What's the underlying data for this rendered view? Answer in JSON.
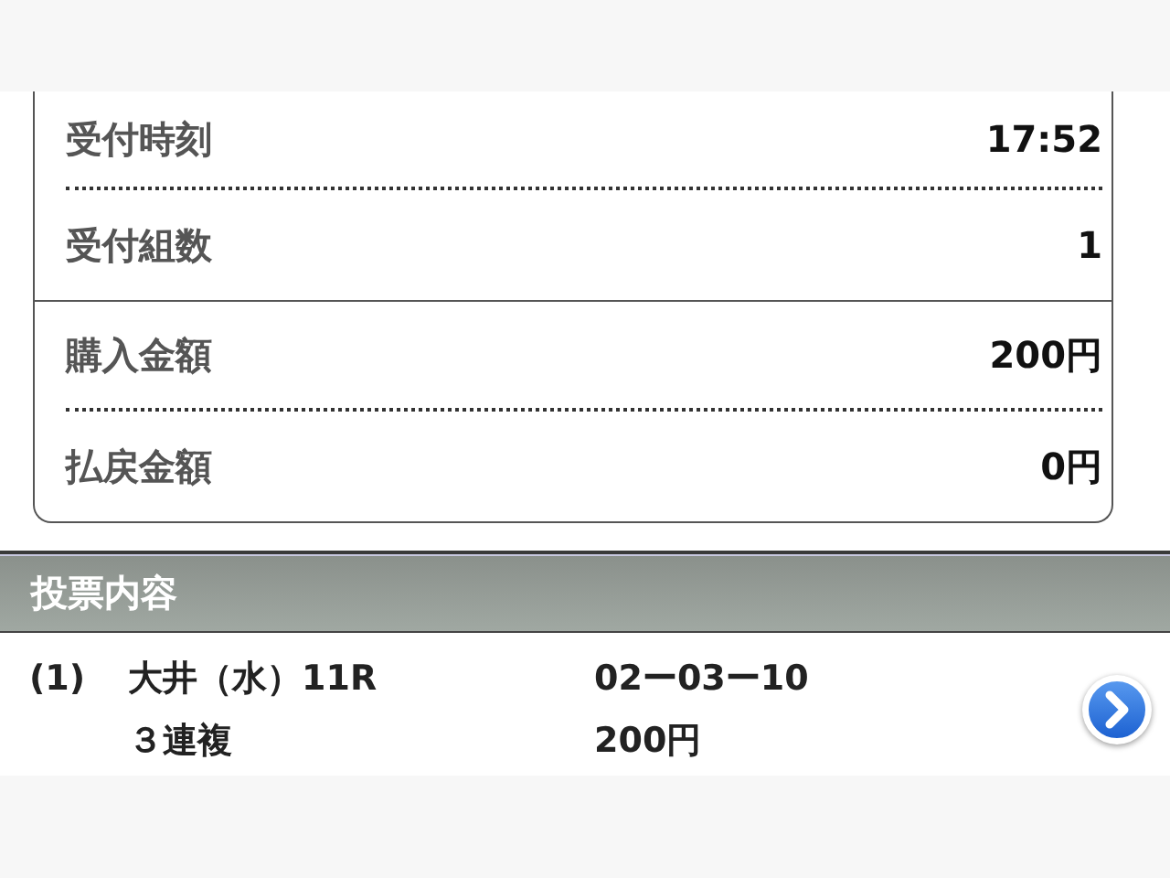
{
  "summary": {
    "groups": [
      [
        {
          "label": "受付時刻",
          "value": "17:52"
        },
        {
          "label": "受付組数",
          "value": "1"
        }
      ],
      [
        {
          "label": "購入金額",
          "value": "200円"
        },
        {
          "label": "払戻金額",
          "value": "0円"
        }
      ]
    ]
  },
  "section": {
    "title": "投票内容"
  },
  "bets": [
    {
      "number": "(1)",
      "race": "大井（水）11R",
      "bet_type": "３連複",
      "combination": "02ー03ー10",
      "amount": "200円"
    }
  ]
}
